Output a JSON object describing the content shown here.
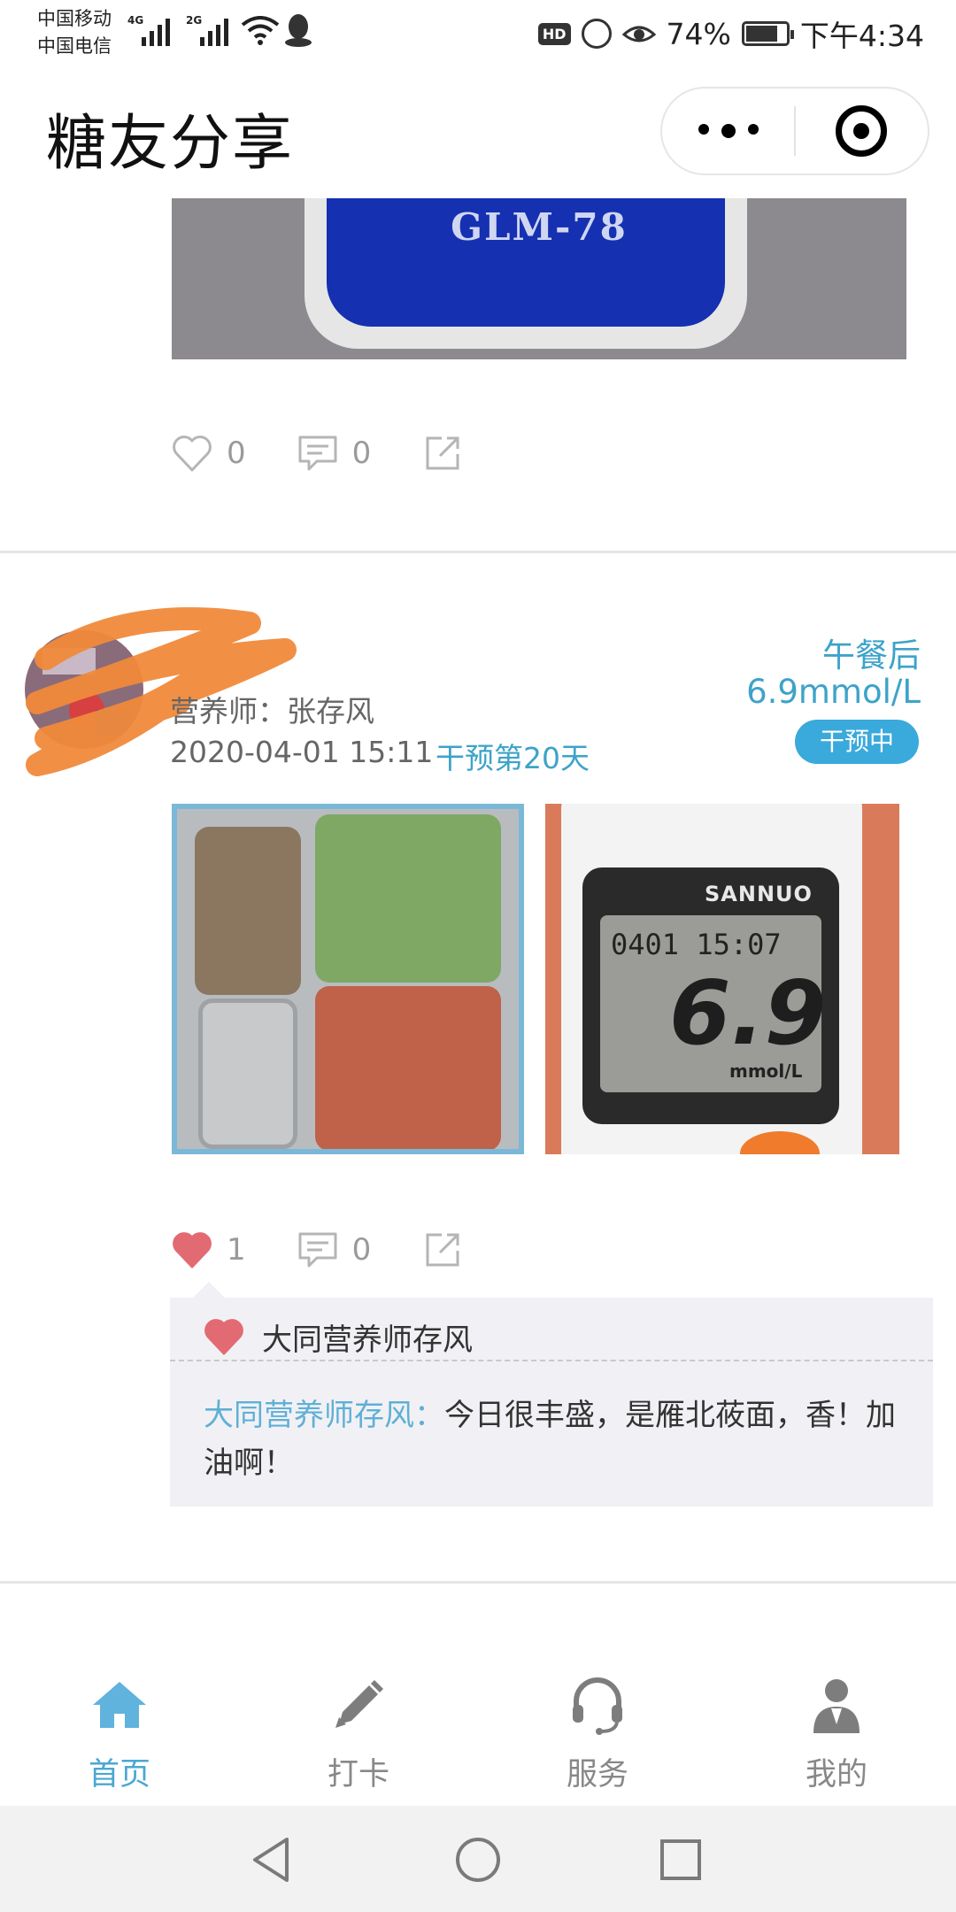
{
  "status_bar": {
    "carrier_1": "中国移动",
    "carrier_2": "中国电信",
    "network_1": "4G",
    "network_2": "2G",
    "hd": "HD",
    "battery": "74%",
    "time": "下午4:34",
    "icons": [
      "signal-icon",
      "wifi-icon",
      "qq-icon",
      "volte-icon",
      "eye-icon",
      "battery-icon"
    ]
  },
  "nav": {
    "title": "糖友分享",
    "icons": [
      "more-icon",
      "target-icon"
    ]
  },
  "post_prev": {
    "photo_text": "GLM-78",
    "likes": "0",
    "comments": "0"
  },
  "post": {
    "nutritionist": "营养师：张存风",
    "datetime": "2020-04-01 15:11",
    "days": "干预第20天",
    "meal": "午餐后",
    "glucose": "6.9mmol/L",
    "status": "干预中",
    "meter": {
      "brand": "SANNUO",
      "datetime": "0401 15:07",
      "value": "6.9",
      "unit": "mmol/L"
    },
    "likes": "1",
    "comments": "0",
    "liked_by": "大同营养师存风",
    "comment_author": "大同营养师存风：",
    "comment_text": "今日很丰盛，是雁北莜面，香！加油啊！"
  },
  "tabs": [
    {
      "label": "首页",
      "icon": "home-icon",
      "active": true
    },
    {
      "label": "打卡",
      "icon": "pencil-icon",
      "active": false
    },
    {
      "label": "服务",
      "icon": "headset-icon",
      "active": false
    },
    {
      "label": "我的",
      "icon": "doctor-icon",
      "active": false
    }
  ],
  "colors": {
    "accent": "#3da3c9",
    "badge": "#3aa9db",
    "like": "#e26b73",
    "tab_active": "#4aa7d4"
  }
}
